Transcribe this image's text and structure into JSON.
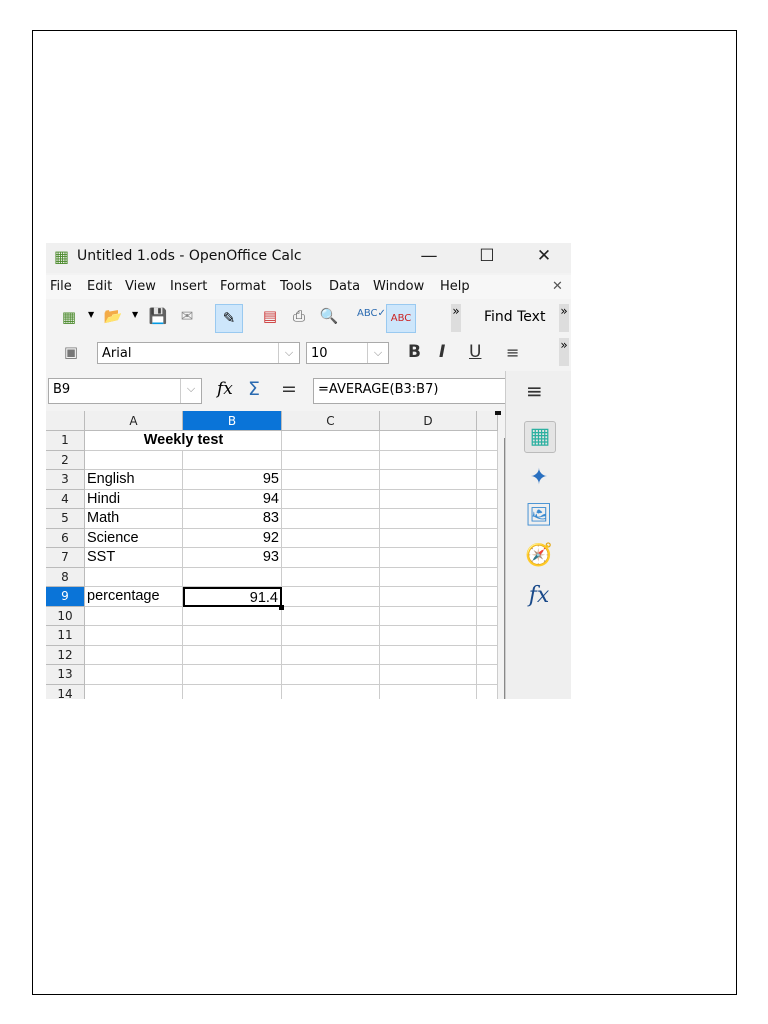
{
  "window": {
    "title": "Untitled 1.ods - OpenOffice Calc",
    "minimize": "—",
    "maximize": "☐",
    "close": "✕"
  },
  "menu": {
    "items": [
      "File",
      "Edit",
      "View",
      "Insert",
      "Format",
      "Tools",
      "Data",
      "Window",
      "Help"
    ],
    "close": "✕"
  },
  "toolbar": {
    "find_text": "Find Text",
    "more": "»"
  },
  "format": {
    "font_name": "Arial",
    "font_size": "10",
    "bold": "B",
    "italic": "I",
    "underline": "U",
    "align": "≡"
  },
  "formula": {
    "name_box": "B9",
    "fx": "fx",
    "sum": "Σ",
    "equals": "=",
    "content": "=AVERAGE(B3:B7)"
  },
  "sheet": {
    "columns": [
      "A",
      "B",
      "C",
      "D"
    ],
    "rows": [
      "1",
      "2",
      "3",
      "4",
      "5",
      "6",
      "7",
      "8",
      "9",
      "10",
      "11",
      "12",
      "13",
      "14"
    ],
    "title": "Weekly test",
    "subjects": [
      {
        "name": "English",
        "score": "95"
      },
      {
        "name": "Hindi",
        "score": "94"
      },
      {
        "name": "Math",
        "score": "83"
      },
      {
        "name": "Science",
        "score": "92"
      },
      {
        "name": "SST",
        "score": "93"
      }
    ],
    "result_label": "percentage",
    "result_value": "91.4"
  },
  "colors": {
    "selection": "#0a74d8"
  }
}
